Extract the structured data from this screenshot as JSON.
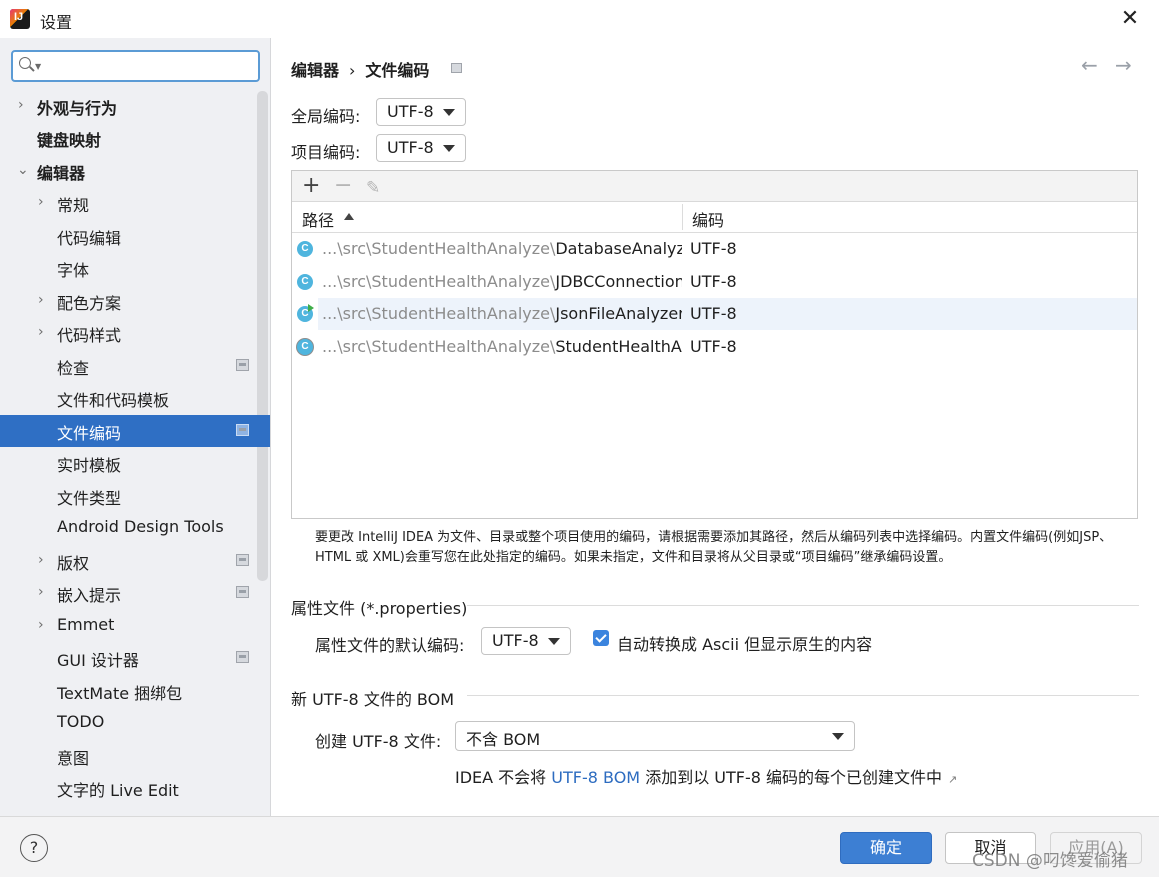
{
  "window": {
    "title": "设置"
  },
  "search": {
    "placeholder": "",
    "value": ""
  },
  "sidebar": {
    "items": [
      {
        "label": "外观与行为"
      },
      {
        "label": "键盘映射"
      },
      {
        "label": "编辑器"
      },
      {
        "label": "常规"
      },
      {
        "label": "代码编辑"
      },
      {
        "label": "字体"
      },
      {
        "label": "配色方案"
      },
      {
        "label": "代码样式"
      },
      {
        "label": "检查"
      },
      {
        "label": "文件和代码模板"
      },
      {
        "label": "文件编码"
      },
      {
        "label": "实时模板"
      },
      {
        "label": "文件类型"
      },
      {
        "label": "Android Design Tools"
      },
      {
        "label": "版权"
      },
      {
        "label": "嵌入提示"
      },
      {
        "label": "Emmet"
      },
      {
        "label": "GUI 设计器"
      },
      {
        "label": "TextMate 捆绑包"
      },
      {
        "label": "TODO"
      },
      {
        "label": "意图"
      },
      {
        "label": "文字的 Live Edit"
      }
    ]
  },
  "breadcrumb": {
    "parent": "编辑器",
    "separator": "›",
    "current": "文件编码"
  },
  "encoding": {
    "global_label": "全局编码:",
    "global_value": "UTF-8",
    "project_label": "项目编码:",
    "project_value": "UTF-8"
  },
  "table": {
    "toolbar": {
      "add": "+",
      "remove": "−",
      "edit": "✎"
    },
    "columns": [
      "路径",
      "编码"
    ],
    "rows": [
      {
        "path_prefix": "...\\src\\StudentHealthAnalyze\\",
        "file": "DatabaseAnalyzer",
        "encoding": "UTF-8"
      },
      {
        "path_prefix": "...\\src\\StudentHealthAnalyze\\",
        "file": "JDBCConnection.ja",
        "encoding": "UTF-8"
      },
      {
        "path_prefix": "...\\src\\StudentHealthAnalyze\\",
        "file": "JsonFileAnalyzer.ja",
        "encoding": "UTF-8"
      },
      {
        "path_prefix": "...\\src\\StudentHealthAnalyze\\",
        "file": "StudentHealthAna",
        "encoding": "UTF-8"
      }
    ]
  },
  "note": {
    "line1": "要更改 IntelliJ IDEA 为文件、目录或整个项目使用的编码，请根据需要添加其路径，然后从编码列表中选择编码。内置文件编码(例如JSP、",
    "line2": "HTML 或 XML)会重写您在此处指定的编码。如果未指定，文件和目录将从父目录或“项目编码”继承编码设置。"
  },
  "properties": {
    "section": "属性文件 (*.properties)",
    "default_label": "属性文件的默认编码:",
    "default_value": "UTF-8",
    "checkbox_label": "自动转换成 Ascii 但显示原生的内容",
    "checked": true
  },
  "bom": {
    "section": "新 UTF-8 文件的 BOM",
    "create_label": "创建 UTF-8 文件:",
    "create_value": "不含 BOM",
    "info_prefix": "IDEA 不会将 ",
    "info_link": "UTF-8 BOM",
    "info_suffix": " 添加到以 UTF-8 编码的每个已创建文件中",
    "info_ext": "↗"
  },
  "footer": {
    "help": "?",
    "ok": "确定",
    "cancel": "取消",
    "apply": "应用(A)"
  },
  "watermark": "CSDN @叼馋爱偷猪",
  "colors": {
    "accent": "#2f6fc4",
    "link": "#2d6cc0",
    "ok_button": "#3d7fd3"
  }
}
